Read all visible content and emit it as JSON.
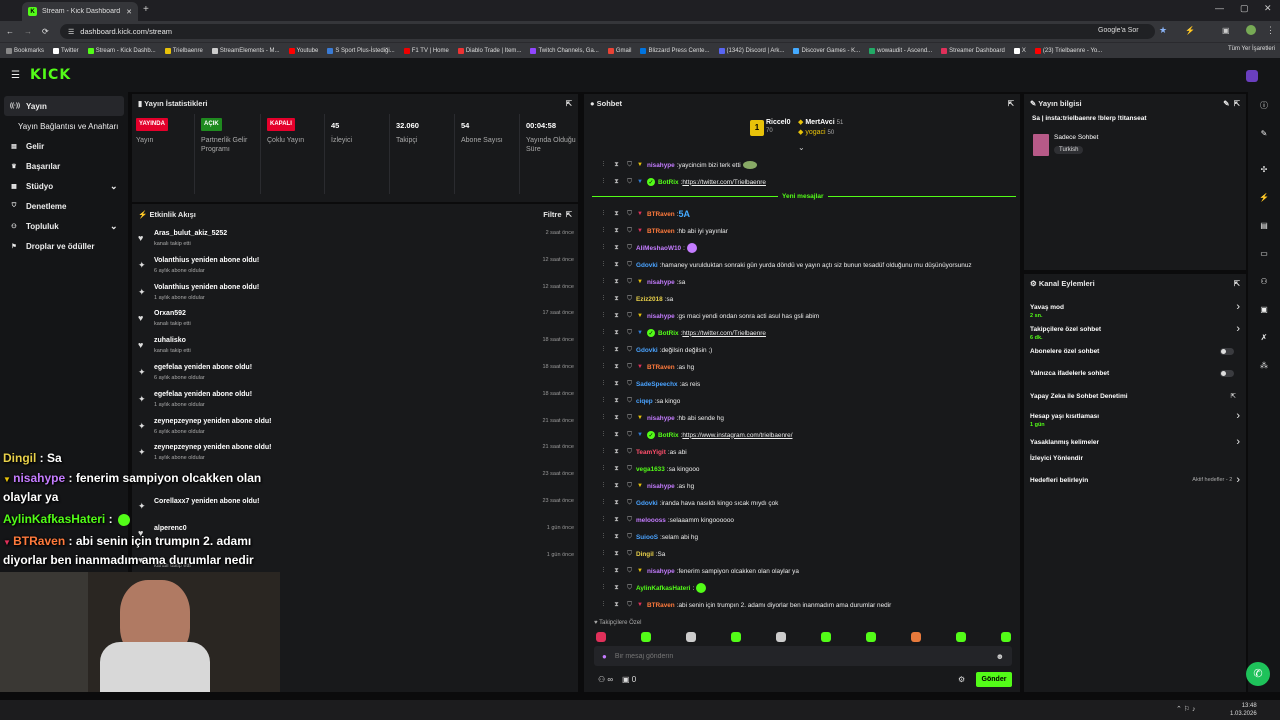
{
  "browser": {
    "tab_title": "Stream - Kick Dashboard",
    "url": "dashboard.kick.com/stream",
    "google_chip": "Google'a Sor",
    "bookmarks": [
      "Bookmarks",
      "Twitter",
      "Stream - Kick Dashb...",
      "Trielbaenre",
      "StreamElements - M...",
      "Youtube",
      "S Sport Plus-İstediği...",
      "F1 TV | Home",
      "Diablo Trade | Item...",
      "Twitch Channels, Ga...",
      "Gmail",
      "Blizzard Press Cente...",
      "(1342) Discord | Ark...",
      "Discover Games - K...",
      "wowaudit - Ascend...",
      "Streamer Dashboard",
      "X",
      "(23) Trielbaenre - Yo..."
    ],
    "all_bookmarks": "Tüm Yer İşaretleri"
  },
  "logo": "KICK",
  "leftnav": {
    "items": [
      {
        "label": "Yayın",
        "icon": "broadcast-icon"
      },
      {
        "label": "Yayın Bağlantısı ve Anahtarı",
        "icon": ""
      },
      {
        "label": "Gelir",
        "icon": "money-icon"
      },
      {
        "label": "Başarılar",
        "icon": "trophy-icon"
      },
      {
        "label": "Stüdyo",
        "icon": "studio-icon"
      },
      {
        "label": "Denetleme",
        "icon": "shield-icon"
      },
      {
        "label": "Topluluk",
        "icon": "community-icon"
      },
      {
        "label": "Droplar ve ödüller",
        "icon": "gift-icon"
      }
    ]
  },
  "stats": {
    "title": "Yayın İstatistikleri",
    "items": [
      {
        "badge": "YAYINDA",
        "badge_color": "#e4002b",
        "label": "Yayın"
      },
      {
        "badge": "AÇIK",
        "badge_color": "#1f8a1f",
        "label": "Partnerlik Gelir Programı"
      },
      {
        "badge": "KAPALI",
        "badge_color": "#e4002b",
        "label": "Çoklu Yayın"
      },
      {
        "value": "45",
        "label": "İzleyici"
      },
      {
        "value": "32.060",
        "label": "Takipçi"
      },
      {
        "value": "54",
        "label": "Abone Sayısı"
      },
      {
        "value": "00:04:58",
        "label": "Yayında Olduğu Süre"
      }
    ]
  },
  "feed": {
    "title": "Etkinlik Akışı",
    "filter": "Filtre",
    "items": [
      {
        "icon": "heart-icon",
        "title": "Aras_bulut_akiz_5252",
        "sub": "kanalı takip etti",
        "time": "2 saat önce"
      },
      {
        "icon": "sparkle-icon",
        "title": "Volanthius yeniden abone oldu!",
        "sub": "6 aylık abone oldular",
        "time": "12 saat önce"
      },
      {
        "icon": "sparkle-icon",
        "title": "Volanthius yeniden abone oldu!",
        "sub": "1 aylık abone oldular",
        "time": "12 saat önce"
      },
      {
        "icon": "heart-icon",
        "title": "Orxan592",
        "sub": "kanalı takip etti",
        "time": "17 saat önce"
      },
      {
        "icon": "heart-icon",
        "title": "zuhalisko",
        "sub": "kanalı takip etti",
        "time": "18 saat önce"
      },
      {
        "icon": "sparkle-icon",
        "title": "egefelaa yeniden abone oldu!",
        "sub": "6 aylık abone oldular",
        "time": "18 saat önce"
      },
      {
        "icon": "sparkle-icon",
        "title": "egefelaa yeniden abone oldu!",
        "sub": "1 aylık abone oldular",
        "time": "18 saat önce"
      },
      {
        "icon": "sparkle-icon",
        "title": "zeynepzeynep yeniden abone oldu!",
        "sub": "6 aylık abone oldular",
        "time": "21 saat önce"
      },
      {
        "icon": "sparkle-icon",
        "title": "zeynepzeynep yeniden abone oldu!",
        "sub": "1 aylık abone oldular",
        "time": "21 saat önce"
      },
      {
        "icon": "sparkle-icon",
        "title": "",
        "sub": "",
        "time": "23 saat önce"
      },
      {
        "icon": "sparkle-icon",
        "title": "Corellaxx7 yeniden abone oldu!",
        "sub": "",
        "time": "23 saat önce"
      },
      {
        "icon": "heart-icon",
        "title": "alperenc0",
        "sub": "",
        "time": "1 gün önce"
      },
      {
        "icon": "heart-icon",
        "title": "",
        "sub": "kanalı takip etti",
        "time": "1 gün önce"
      }
    ]
  },
  "chat": {
    "title": "Sohbet",
    "top": [
      {
        "name": "Riccel0",
        "count": "70"
      },
      {
        "name": "MertAvci",
        "count": "51"
      },
      {
        "name": "yogaci",
        "count": "50"
      }
    ],
    "new_messages": "Yeni mesajlar",
    "messages": [
      {
        "user": "nisahype",
        "color": "#c47cff",
        "badge": "#e8c20a",
        "text": "yaycincim bizi terk etti"
      },
      {
        "user": "BotRix",
        "color": "#53fc18",
        "badge": "#2e7bd6",
        "text": "https://twitter.com/Trielbaenre",
        "link": true
      },
      {
        "user": "BTRaven",
        "color": "#ff7a3c",
        "badge": "#e0305a",
        "text": "5A"
      },
      {
        "user": "BTRaven",
        "color": "#ff7a3c",
        "badge": "#e0305a",
        "text": "hb abi iyi yayınlar"
      },
      {
        "user": "AliMeshaoW10",
        "color": "#c47cff",
        "badge": "",
        "text": ""
      },
      {
        "user": "Gdovki",
        "color": "#4aa3ff",
        "badge": "",
        "text": "hamaney vurulduktan sonraki gün yurda döndü ve yayın açtı siz bunun tesadüf olduğunu mu düşünüyorsunuz"
      },
      {
        "user": "nisahype",
        "color": "#c47cff",
        "badge": "#e8c20a",
        "text": "sa"
      },
      {
        "user": "Eziz2018",
        "color": "#e8d04a",
        "badge": "",
        "text": "sa"
      },
      {
        "user": "nisahype",
        "color": "#c47cff",
        "badge": "#e8c20a",
        "text": "gs maci yendi ondan sonra acti asul has gsli abim"
      },
      {
        "user": "BotRix",
        "color": "#53fc18",
        "badge": "#2e7bd6",
        "text": "https://twitter.com/Trielbaenre",
        "link": true
      },
      {
        "user": "Gdovki",
        "color": "#4aa3ff",
        "badge": "",
        "text": "değilsin değilsin ;)"
      },
      {
        "user": "BTRaven",
        "color": "#ff7a3c",
        "badge": "#e0305a",
        "text": "as hg"
      },
      {
        "user": "SadeSpeechx",
        "color": "#4aa3ff",
        "badge": "",
        "text": "as reis"
      },
      {
        "user": "ciqep",
        "color": "#4aa3ff",
        "badge": "",
        "text": "sa kingo"
      },
      {
        "user": "nisahype",
        "color": "#c47cff",
        "badge": "#e8c20a",
        "text": "hb abi sende hg"
      },
      {
        "user": "BotRix",
        "color": "#53fc18",
        "badge": "#2e7bd6",
        "text": "https://www.instagram.com/trielbaenre/",
        "link": true
      },
      {
        "user": "TeamYigit",
        "color": "#ff4f6b",
        "badge": "",
        "text": "as abi"
      },
      {
        "user": "vega1633",
        "color": "#53fc18",
        "badge": "",
        "text": "sa kingooo"
      },
      {
        "user": "nisahype",
        "color": "#c47cff",
        "badge": "#e8c20a",
        "text": "as hg"
      },
      {
        "user": "Gdovki",
        "color": "#4aa3ff",
        "badge": "",
        "text": "iranda hava nasıldı kingo sıcak mıydı çok"
      },
      {
        "user": "meloooss",
        "color": "#c47cff",
        "badge": "",
        "text": "selaaamm kingoooooo"
      },
      {
        "user": "SuiooS",
        "color": "#4aa3ff",
        "badge": "",
        "text": "selam abi hg"
      },
      {
        "user": "Dingil",
        "color": "#e8d04a",
        "badge": "",
        "text": "Sa"
      },
      {
        "user": "nisahype",
        "color": "#c47cff",
        "badge": "#e8c20a",
        "text": "fenerim sampiyon olcakken olan olaylar ya"
      },
      {
        "user": "AylinKafkasHateri",
        "color": "#53fc18",
        "badge": "",
        "text": ""
      },
      {
        "user": "BTRaven",
        "color": "#ff7a3c",
        "badge": "#e0305a",
        "text": "abi senin için trumpın 2. adamı diyorlar ben inanmadım ama durumlar nedir"
      }
    ],
    "followers_only": "Takipçilere Özel",
    "input_placeholder": "Bir mesaj gönderin",
    "points": "0",
    "send": "Gönder"
  },
  "stream_info": {
    "title": "Yayın bilgisi",
    "stream_title": "Sa | insta:trielbaenre !blerp !titanseat",
    "category": "Sadece Sohbet",
    "tag": "Turkish"
  },
  "channel_actions": {
    "title": "Kanal Eylemleri",
    "items": [
      {
        "label": "Yavaş mod",
        "sub": "2 sn.",
        "type": "arrow"
      },
      {
        "label": "Takipçilere özel sohbet",
        "sub": "6 dk.",
        "type": "arrow"
      },
      {
        "label": "Abonelere özel sohbet",
        "sub": "",
        "type": "toggle"
      },
      {
        "label": "Yalnızca ifadelerle sohbet",
        "sub": "",
        "type": "toggle"
      },
      {
        "label": "Yapay Zeka ile Sohbet Denetimi",
        "sub": "",
        "type": "ext"
      },
      {
        "label": "Hesap yaşı kısıtlaması",
        "sub": "1 gün",
        "type": "arrow"
      },
      {
        "label": "Yasaklanmış kelimeler",
        "sub": "",
        "type": "arrow"
      },
      {
        "label": "İzleyici Yönlendir",
        "sub": "",
        "type": "none"
      },
      {
        "label": "Hedefleri belirleyin",
        "sub": "",
        "type": "arrow",
        "right": "Aktif hedefler - 2"
      }
    ]
  },
  "overlay": {
    "lines": [
      {
        "user": "Dingil",
        "text": "Sa",
        "color": "#e8d04a"
      },
      {
        "user": "nisahype",
        "text": "fenerim sampiyon olcakken olan",
        "color": "#c47cff"
      },
      {
        "user": "",
        "text": "olaylar ya",
        "color": ""
      },
      {
        "user": "AylinKafkasHateri",
        "text": "",
        "color": "#53fc18"
      },
      {
        "user": "BTRaven",
        "text": "abi senin için trumpın 2. adamı",
        "color": "#ff7a3c"
      },
      {
        "user": "",
        "text": "diyorlar ben inanmadım ama durumlar nedir",
        "color": ""
      }
    ]
  },
  "taskbar": {
    "time": "13:48",
    "date": "1.03.2026"
  }
}
